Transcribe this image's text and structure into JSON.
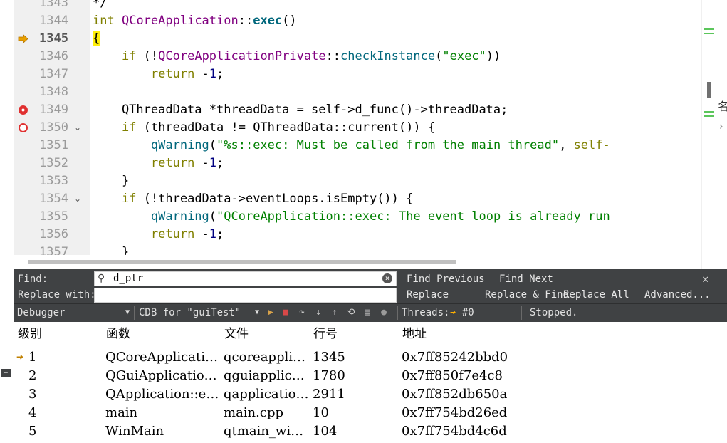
{
  "editor": {
    "lines": [
      {
        "num": "1343",
        "code_html": "*/"
      },
      {
        "num": "1344",
        "code_html": "<span class='kw'>int</span> <span class='cls'>QCoreApplication</span>::<span class='fn-bold'>exec</span>()"
      },
      {
        "num": "1345",
        "code_html": "<span class='brace-hl'>{</span>",
        "current": true
      },
      {
        "num": "1346",
        "code_html": "    <span class='kw'>if</span> (!<span class='cls'>QCoreApplicationPrivate</span>::<span class='fn'>checkInstance</span>(<span class='str'>\"exec\"</span>))"
      },
      {
        "num": "1347",
        "code_html": "        <span class='kw'>return</span> -<span class='num'>1</span>;"
      },
      {
        "num": "1348",
        "code_html": ""
      },
      {
        "num": "1349",
        "code_html": "    QThreadData *threadData = self->d_func()->threadData;",
        "breakpoint": "filled"
      },
      {
        "num": "1350",
        "code_html": "    <span class='kw'>if</span> (threadData != QThreadData::current()) {",
        "breakpoint": "hollow",
        "fold": true
      },
      {
        "num": "1351",
        "code_html": "        <span class='fn'>qWarning</span>(<span class='str'>\"%s::exec: Must be called from the main thread\"</span>, <span class='kw'>self-</span>"
      },
      {
        "num": "1352",
        "code_html": "        <span class='kw'>return</span> -<span class='num'>1</span>;"
      },
      {
        "num": "1353",
        "code_html": "    }"
      },
      {
        "num": "1354",
        "code_html": "    <span class='kw'>if</span> (!threadData->eventLoops.isEmpty()) {",
        "fold": true
      },
      {
        "num": "1355",
        "code_html": "        <span class='fn'>qWarning</span>(<span class='str'>\"QCoreApplication::exec: The event loop is already run</span>"
      },
      {
        "num": "1356",
        "code_html": "        <span class='kw'>return</span> -<span class='num'>1</span>;"
      },
      {
        "num": "1357",
        "code_html": "    }"
      }
    ]
  },
  "find": {
    "find_label": "Find:",
    "replace_label": "Replace with:",
    "find_value": "d_ptr",
    "replace_value": "",
    "find_previous": "Find Previous",
    "find_next": "Find Next",
    "replace": "Replace",
    "replace_find": "Replace & Find",
    "replace_all": "Replace All",
    "advanced": "Advanced..."
  },
  "debugger": {
    "combo1": "Debugger",
    "combo2": "CDB for \"guiTest\"",
    "threads_label": "Threads:",
    "threads_value": "#0",
    "status": "Stopped."
  },
  "stack": {
    "headers": {
      "level": "级别",
      "function": "函数",
      "file": "文件",
      "line": "行号",
      "address": "地址"
    },
    "rows": [
      {
        "level": "1",
        "function": "QCoreApplicati…",
        "file": "qcoreappli…",
        "line": "1345",
        "address": "0x7ff85242bbd0",
        "current": true
      },
      {
        "level": "2",
        "function": "QGuiApplicatio…",
        "file": "qguiapplic…",
        "line": "1780",
        "address": "0x7ff850f7e4c8"
      },
      {
        "level": "3",
        "function": "QApplication::e…",
        "file": "qapplicatio…",
        "line": "2911",
        "address": "0x7ff852db650a"
      },
      {
        "level": "4",
        "function": "main",
        "file": "main.cpp",
        "line": "10",
        "address": "0x7ff754bd26ed"
      },
      {
        "level": "5",
        "function": "WinMain",
        "file": "qtmain_wi…",
        "line": "104",
        "address": "0x7ff754bd4c6d"
      }
    ]
  },
  "right_strip_glyph": "名",
  "colors": {
    "panel_bg": "#404244",
    "breakpoint": "#e03030",
    "current_line_arrow": "#e8a000",
    "brace_highlight": "#ffef0b"
  }
}
